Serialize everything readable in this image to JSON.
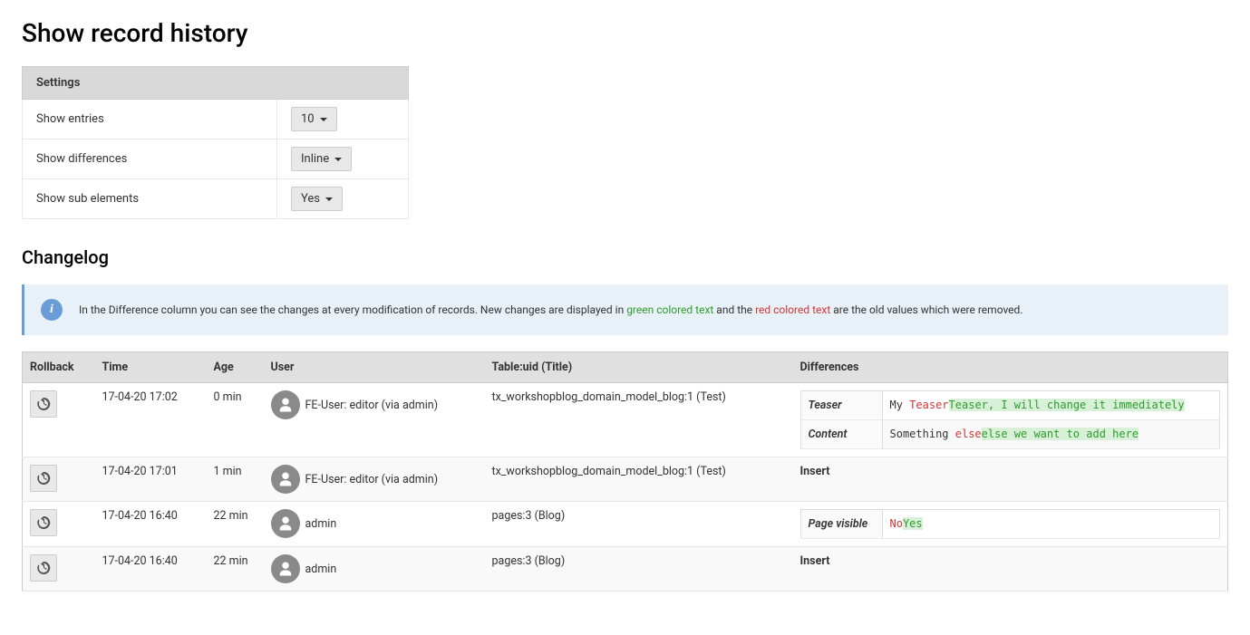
{
  "page_title": "Show record history",
  "settings": {
    "header": "Settings",
    "rows": [
      {
        "label": "Show entries",
        "value": "10"
      },
      {
        "label": "Show differences",
        "value": "Inline"
      },
      {
        "label": "Show sub elements",
        "value": "Yes"
      }
    ]
  },
  "changelog": {
    "heading": "Changelog",
    "info": {
      "pre": "In the Difference column you can see the changes at every modification of records. New changes are displayed in ",
      "green": "green colored text",
      "mid": " and the ",
      "red": "red colored text",
      "post": " are the old values which were removed."
    },
    "columns": {
      "rollback": "Rollback",
      "time": "Time",
      "age": "Age",
      "user": "User",
      "table_uid": "Table:uid (Title)",
      "differences": "Differences"
    },
    "rows": [
      {
        "time": "17-04-20 17:02",
        "age": "0 min",
        "user": "FE-User: editor (via admin)",
        "table_uid": "tx_workshopblog_domain_model_blog:1 (Test)",
        "diff_type": "diffs",
        "diffs": [
          {
            "field": "Teaser",
            "context": "My ",
            "old": "Teaser",
            "new": "Teaser, I will change it immediately"
          },
          {
            "field": "Content",
            "context": "Something ",
            "old": "else",
            "new": "else we want to add here"
          }
        ]
      },
      {
        "time": "17-04-20 17:01",
        "age": "1 min",
        "user": "FE-User: editor (via admin)",
        "table_uid": "tx_workshopblog_domain_model_blog:1 (Test)",
        "diff_type": "text",
        "diff_text": "Insert"
      },
      {
        "time": "17-04-20 16:40",
        "age": "22 min",
        "user": "admin",
        "table_uid": "pages:3 (Blog)",
        "diff_type": "diffs",
        "diffs": [
          {
            "field": "Page visible",
            "context": "",
            "old": "No",
            "new": "Yes"
          }
        ]
      },
      {
        "time": "17-04-20 16:40",
        "age": "22 min",
        "user": "admin",
        "table_uid": "pages:3 (Blog)",
        "diff_type": "text",
        "diff_text": "Insert"
      }
    ]
  }
}
